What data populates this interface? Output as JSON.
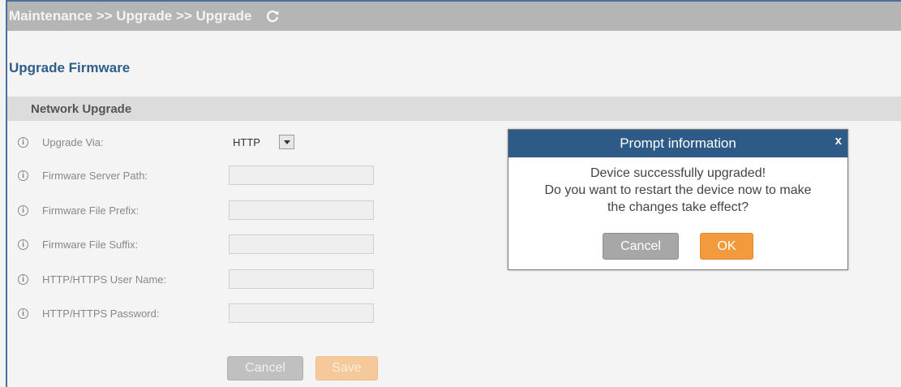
{
  "breadcrumb": {
    "text": "Maintenance >> Upgrade >> Upgrade",
    "refresh_icon": "refresh-icon"
  },
  "page": {
    "title": "Upgrade Firmware"
  },
  "section": {
    "title": "Network Upgrade"
  },
  "form": {
    "upgrade_via": {
      "label": "Upgrade Via:",
      "value": "HTTP"
    },
    "server_path": {
      "label": "Firmware Server Path:",
      "value": ""
    },
    "file_prefix": {
      "label": "Firmware File Prefix:",
      "value": ""
    },
    "file_suffix": {
      "label": "Firmware File Suffix:",
      "value": ""
    },
    "user_name": {
      "label": "HTTP/HTTPS User Name:",
      "value": ""
    },
    "password": {
      "label": "HTTP/HTTPS Password:",
      "value": ""
    },
    "info_glyph": "i"
  },
  "buttons": {
    "cancel": "Cancel",
    "save": "Save"
  },
  "dialog": {
    "title": "Prompt information",
    "close": "x",
    "line1": "Device successfully upgraded!",
    "line2": "Do you want to restart the device now to make",
    "line3": "the changes take effect?",
    "cancel": "Cancel",
    "ok": "OK"
  },
  "colors": {
    "header_blue": "#2d5a87",
    "ok_orange": "#f39a3c",
    "title_blue": "#2f5d8a"
  }
}
